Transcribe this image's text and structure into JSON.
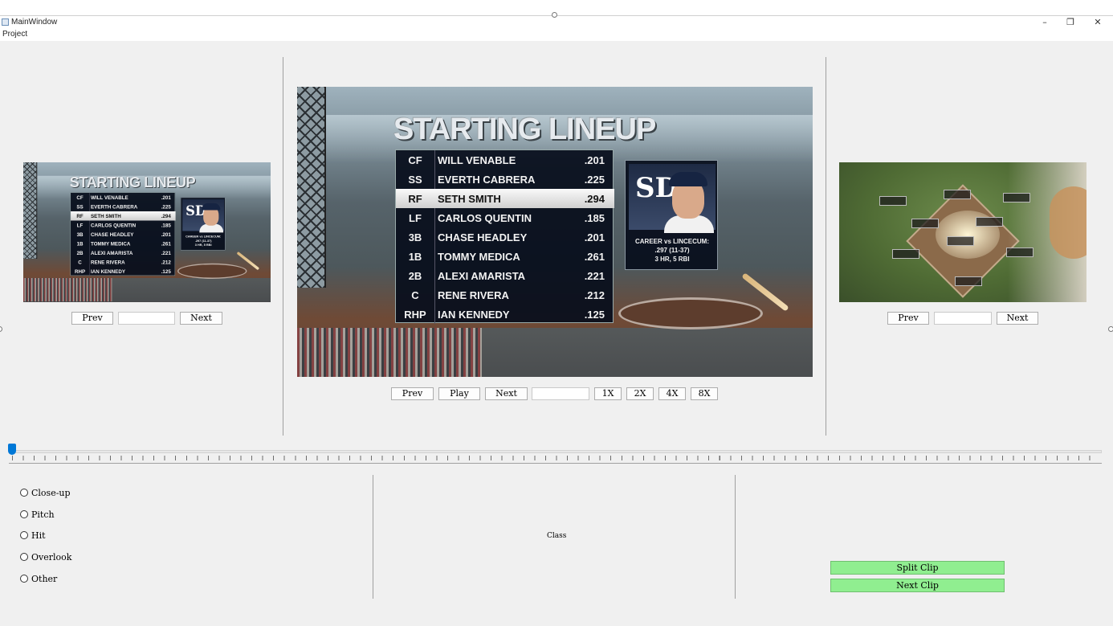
{
  "window": {
    "title": "MainWindow",
    "minimize": "–",
    "restore": "❐",
    "close": "✕"
  },
  "menu": {
    "project": "Project"
  },
  "left_panel": {
    "prev": "Prev",
    "next": "Next",
    "frame_value": ""
  },
  "center_panel": {
    "prev": "Prev",
    "play": "Play",
    "next": "Next",
    "frame_value": "",
    "speeds": [
      "1X",
      "2X",
      "4X",
      "8X"
    ]
  },
  "right_panel": {
    "prev": "Prev",
    "next": "Next",
    "frame_value": ""
  },
  "frame": {
    "title": "STARTING LINEUP",
    "lineup": [
      {
        "pos": "CF",
        "name": "WILL VENABLE",
        "avg": ".201"
      },
      {
        "pos": "SS",
        "name": "EVERTH CABRERA",
        "avg": ".225"
      },
      {
        "pos": "RF",
        "name": "SETH SMITH",
        "avg": ".294"
      },
      {
        "pos": "LF",
        "name": "CARLOS QUENTIN",
        "avg": ".185"
      },
      {
        "pos": "3B",
        "name": "CHASE HEADLEY",
        "avg": ".201"
      },
      {
        "pos": "1B",
        "name": "TOMMY MEDICA",
        "avg": ".261"
      },
      {
        "pos": "2B",
        "name": "ALEXI AMARISTA",
        "avg": ".221"
      },
      {
        "pos": "C",
        "name": "RENE RIVERA",
        "avg": ".212"
      },
      {
        "pos": "RHP",
        "name": "IAN KENNEDY",
        "avg": ".125"
      }
    ],
    "card_logo": "SD",
    "card_line1": "CAREER vs LINCECUM:",
    "card_line2": ".297 (11-37)",
    "card_line3": "3 HR, 5 RBI"
  },
  "timeline": {
    "position": 0
  },
  "categories": [
    "Close-up",
    "Pitch",
    "Hit",
    "Overlook",
    "Other"
  ],
  "class_label": "Class",
  "actions": {
    "split": "Split Clip",
    "next": "Next Clip"
  },
  "colors": {
    "action_button": "#90ee90",
    "slider_handle": "#0078d7"
  }
}
